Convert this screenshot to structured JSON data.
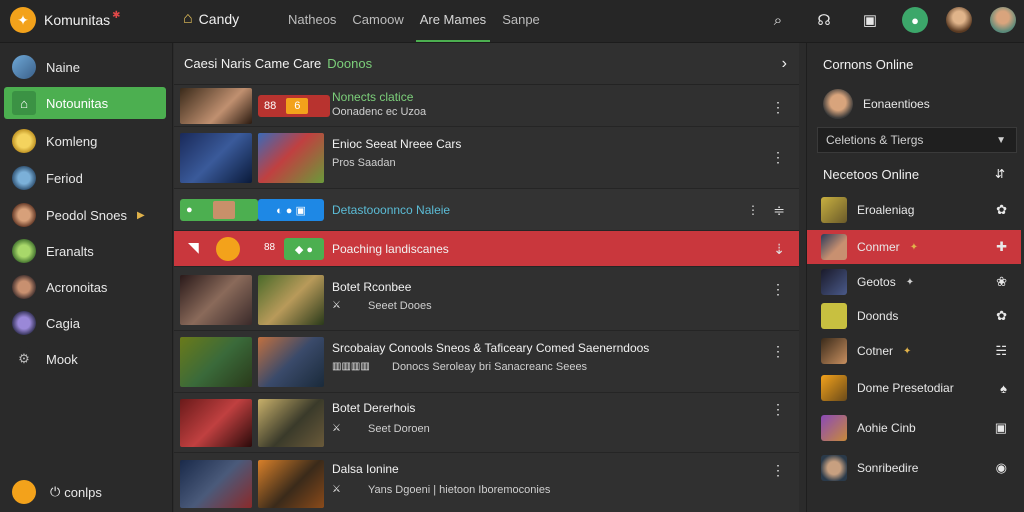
{
  "topbar": {
    "brand": "Komunitas",
    "home": "Candy",
    "tabs": [
      "Natheos",
      "Camoow",
      "Are Mames",
      "Sanpe"
    ]
  },
  "sidebar": {
    "items": [
      {
        "label": "Naine"
      },
      {
        "label": "Notounitas"
      },
      {
        "label": "Komleng"
      },
      {
        "label": "Feriod"
      },
      {
        "label": "Peodol Snoes"
      },
      {
        "label": "Eranalts"
      },
      {
        "label": "Acronoitas"
      },
      {
        "label": "Cagia"
      },
      {
        "label": "Mook"
      }
    ],
    "footer": "conlps"
  },
  "feed": {
    "header": "Caesi Naris Came Care",
    "header_sub": "Doonos",
    "rows": [
      {
        "title": "Nonects clatice",
        "sub": "Oonadenc ec Uzoa"
      },
      {
        "title": "Enioc Seeat Nreee Cars",
        "sub": "Pros Saadan"
      },
      {
        "title": "Detastooonnco Naleie",
        "sub": ""
      },
      {
        "title": "Poaching landiscanes",
        "sub": ""
      },
      {
        "title": "Botet Rconbee",
        "sub": "Seeet Dooes"
      },
      {
        "title": "Srcobaiay Conools Sneos & Taficeary Comed Saenerndoos",
        "sub": "Donocs Seroleay bri Sanacreanc Seees"
      },
      {
        "title": "Botet Dererhois",
        "sub": "Seet Doroen"
      },
      {
        "title": "Dalsa Ionine",
        "sub": "Yans Dgoeni | hietoon Iboremoconies"
      }
    ]
  },
  "right": {
    "title": "Cornons Online",
    "user": "Eonaentioes",
    "select": "Celetions & Tiergs",
    "subtitle": "Necetoos Online",
    "friends": [
      {
        "name": "Eroaleniag"
      },
      {
        "name": "Conmer"
      },
      {
        "name": "Geotos"
      },
      {
        "name": "Doonds"
      },
      {
        "name": "Cotner"
      },
      {
        "name": "Dome Presetodiar"
      },
      {
        "name": "Aohie Cinb"
      },
      {
        "name": "Sonribedire"
      }
    ]
  }
}
